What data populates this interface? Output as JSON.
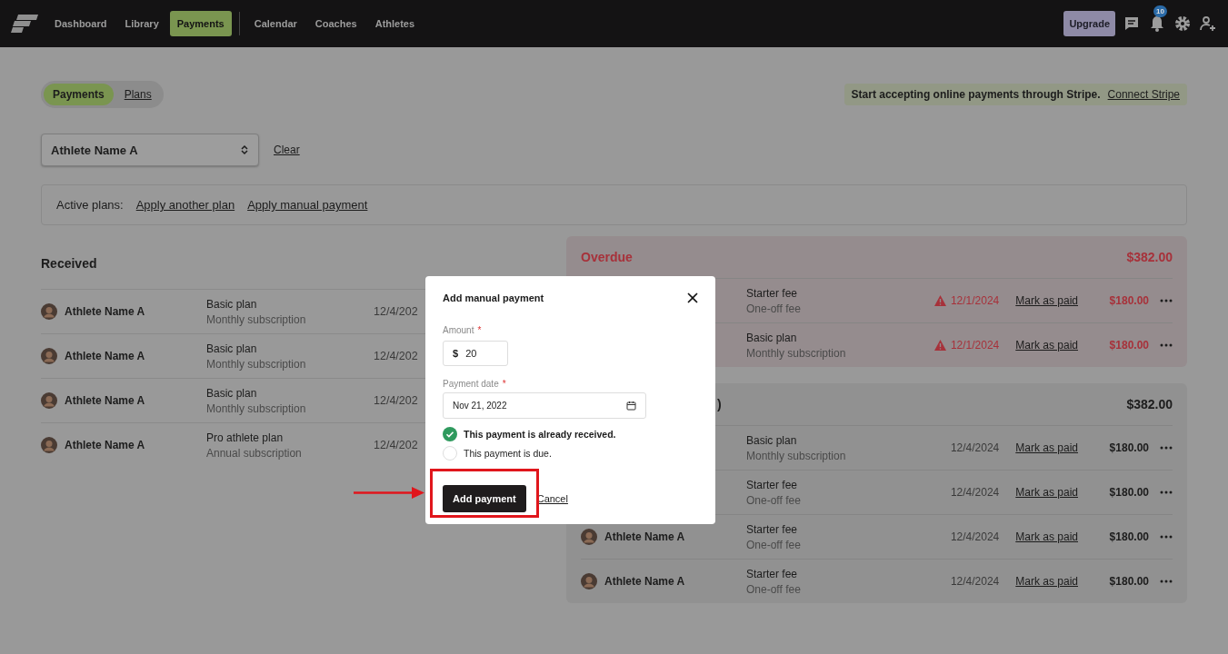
{
  "nav": {
    "items": [
      {
        "label": "Dashboard",
        "selected": false
      },
      {
        "label": "Library",
        "selected": false
      },
      {
        "label": "Payments",
        "selected": true
      },
      {
        "label": "Calendar",
        "selected": false
      },
      {
        "label": "Coaches",
        "selected": false
      },
      {
        "label": "Athletes",
        "selected": false
      }
    ],
    "upgrade": "Upgrade",
    "notification_count": "10"
  },
  "view_toggle": [
    {
      "label": "Payments",
      "selected": true
    },
    {
      "label": "Plans",
      "selected": false
    }
  ],
  "stripe_banner": {
    "message": "Start accepting online payments through Stripe.",
    "link": "Connect Stripe"
  },
  "athlete_select": {
    "value": "Athlete Name A"
  },
  "clear": "Clear",
  "active_plans": {
    "label": "Active plans:",
    "links": [
      "Apply another plan",
      "Apply manual payment"
    ]
  },
  "received": {
    "title": "Received",
    "rows": [
      {
        "athlete": "Athlete Name A",
        "plan": "Basic plan",
        "plan_type": "Monthly subscription",
        "date": "12/4/202"
      },
      {
        "athlete": "Athlete Name A",
        "plan": "Basic plan",
        "plan_type": "Monthly subscription",
        "date": "12/4/202"
      },
      {
        "athlete": "Athlete Name A",
        "plan": "Basic plan",
        "plan_type": "Monthly subscription",
        "date": "12/4/202"
      },
      {
        "athlete": "Athlete Name A",
        "plan": "Pro athlete plan",
        "plan_type": "Annual subscription",
        "date": "12/4/202"
      }
    ]
  },
  "sections": [
    {
      "kind": "overdue",
      "title": "Overdue",
      "total": "$382.00",
      "rows": [
        {
          "plan": "Starter fee",
          "plan_type": "One-off fee",
          "date": "12/1/2024",
          "action": "Mark as paid",
          "amount": "$180.00"
        },
        {
          "plan": "Basic plan",
          "plan_type": "Monthly subscription",
          "date": "12/1/2024",
          "action": "Mark as paid",
          "amount": "$180.00"
        }
      ]
    },
    {
      "kind": "upcoming",
      "title": ")",
      "total": "$382.00",
      "rows": [
        {
          "plan": "Basic plan",
          "plan_type": "Monthly subscription",
          "date": "12/4/2024",
          "action": "Mark as paid",
          "amount": "$180.00"
        },
        {
          "plan": "Starter fee",
          "plan_type": "One-off fee",
          "date": "12/4/2024",
          "action": "Mark as paid",
          "amount": "$180.00"
        },
        {
          "athlete": "Athlete Name A",
          "plan": "Starter fee",
          "plan_type": "One-off fee",
          "date": "12/4/2024",
          "action": "Mark as paid",
          "amount": "$180.00"
        },
        {
          "athlete": "Athlete Name A",
          "plan": "Starter fee",
          "plan_type": "One-off fee",
          "date": "12/4/2024",
          "action": "Mark as paid",
          "amount": "$180.00"
        }
      ]
    }
  ],
  "modal": {
    "title": "Add manual payment",
    "amount": {
      "label": "Amount",
      "required_mark": "*",
      "currency": "$",
      "value": "20"
    },
    "payment_date": {
      "label": "Payment date",
      "required_mark": "*",
      "value": "Nov 21, 2022"
    },
    "options": [
      {
        "label": "This payment is already received.",
        "selected": true
      },
      {
        "label": "This payment is due.",
        "selected": false
      }
    ],
    "submit": "Add payment",
    "cancel": "Cancel"
  }
}
